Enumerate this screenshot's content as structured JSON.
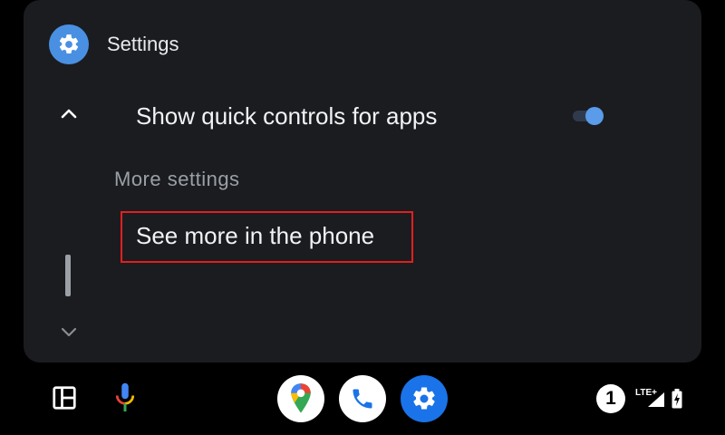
{
  "app": {
    "title": "Settings",
    "icon": "gear-icon",
    "accent": "#4a90e2"
  },
  "list": {
    "toggle_row": {
      "label": "Show quick controls for apps",
      "enabled": true
    },
    "section_header": "More settings",
    "link_row": {
      "label": "See more in the phone"
    }
  },
  "scrollbar": {
    "up_icon": "chevron-up-icon",
    "down_icon": "chevron-down-icon"
  },
  "dock": {
    "launcher_icon": "dashboard-icon",
    "mic_icon": "microphone-icon",
    "apps": [
      "maps-icon",
      "phone-icon",
      "gear-icon"
    ]
  },
  "status": {
    "notification_count": "1",
    "network": "LTE+",
    "signal_icon": "signal-icon",
    "battery_icon": "battery-charging-icon"
  }
}
